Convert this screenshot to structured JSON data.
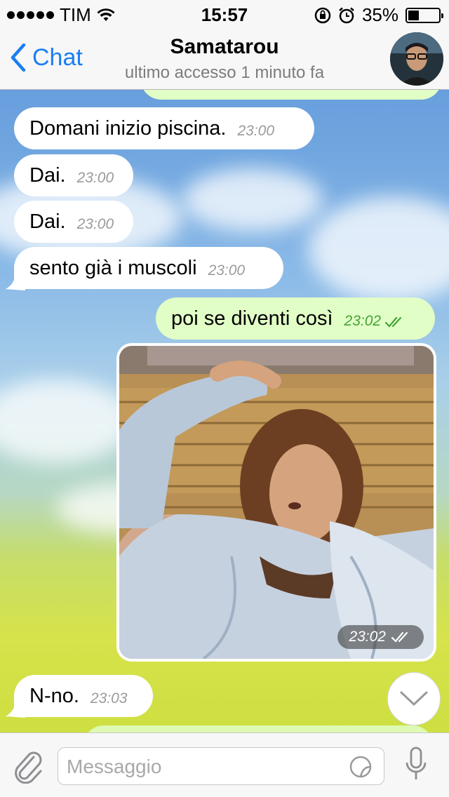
{
  "status_bar": {
    "carrier": "TIM",
    "time": "15:57",
    "battery_text": "35%",
    "battery_level": 0.35
  },
  "header": {
    "back_label": "Chat",
    "title": "Samatarou",
    "subtitle": "ultimo accesso 1 minuto fa"
  },
  "messages": [
    {
      "dir": "in",
      "text": "Domani inizio piscina.",
      "time": "23:00"
    },
    {
      "dir": "in",
      "text": "Dai.",
      "time": "23:00"
    },
    {
      "dir": "in",
      "text": "Dai.",
      "time": "23:00"
    },
    {
      "dir": "in",
      "text": "sento già i muscoli",
      "time": "23:00"
    },
    {
      "dir": "out",
      "text": "poi se diventi così",
      "time": "23:02",
      "status": "read"
    },
    {
      "dir": "out",
      "type": "photo",
      "time": "23:02",
      "status": "read"
    },
    {
      "dir": "in",
      "text": "N-no.",
      "time": "23:03"
    }
  ],
  "input": {
    "placeholder": "Messaggio"
  },
  "colors": {
    "accent": "#1a7ef2",
    "outgoing_bubble": "#e1fec6",
    "incoming_bubble": "#ffffff",
    "read_ticks": "#47a338"
  }
}
